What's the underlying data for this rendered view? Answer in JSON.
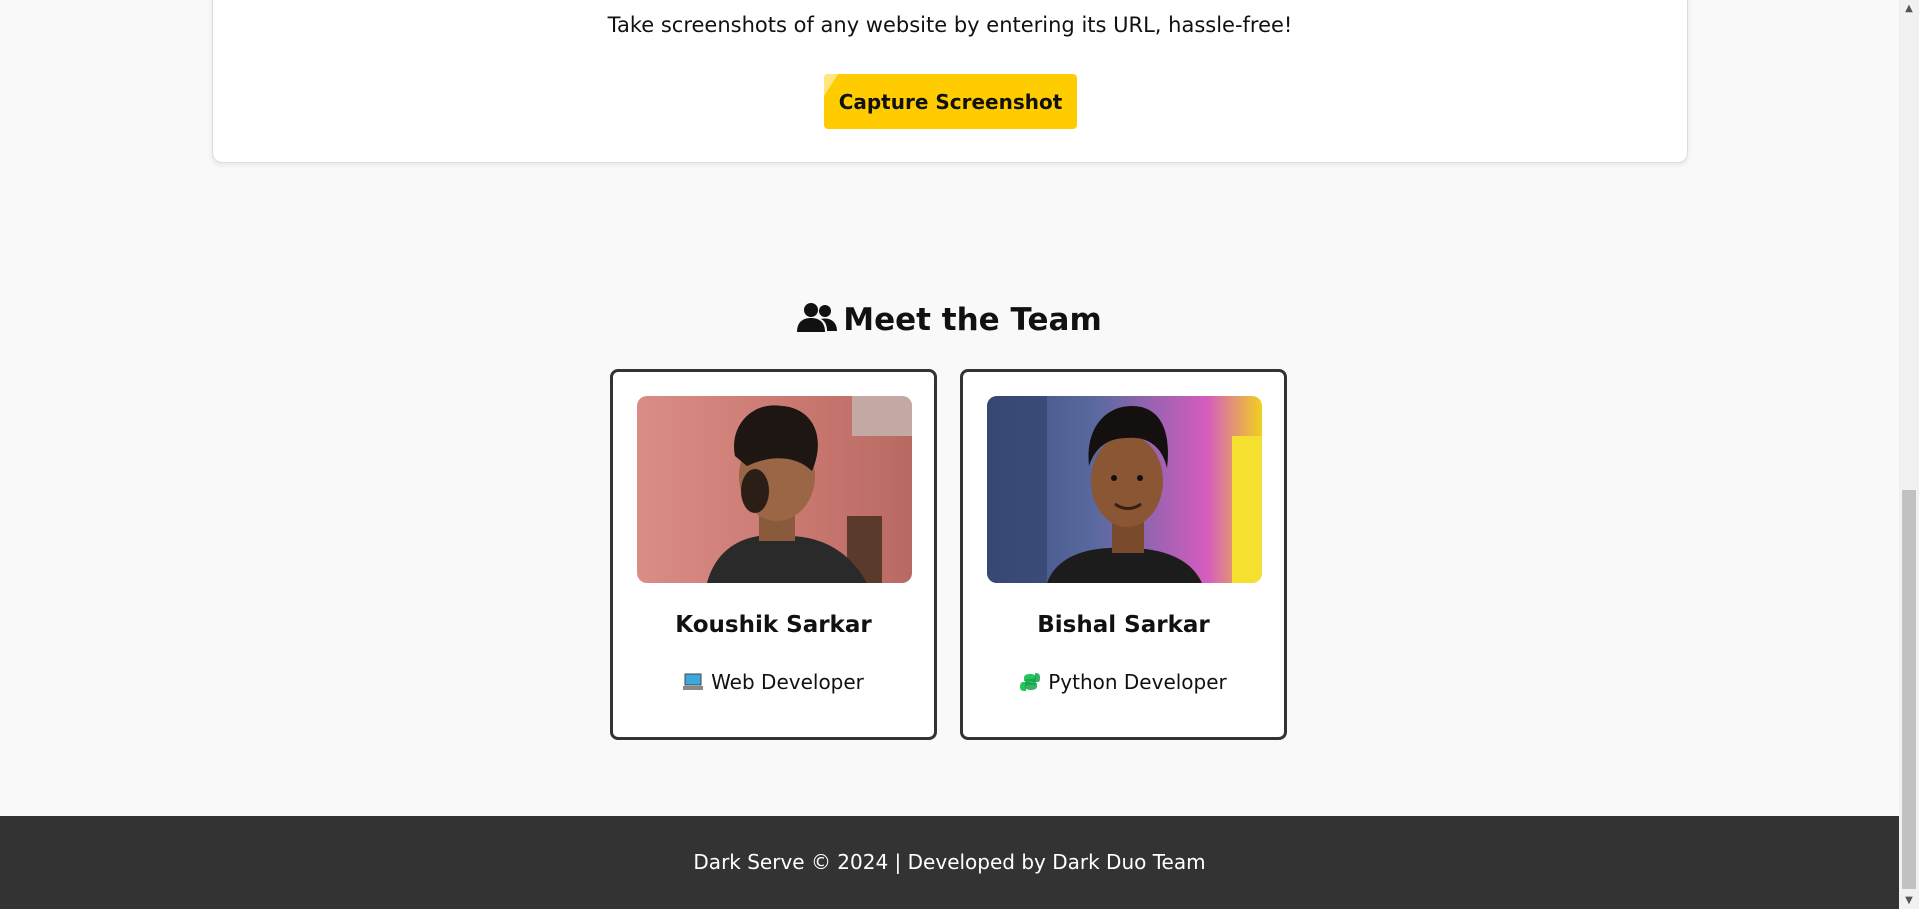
{
  "capture": {
    "subtitle": "Take screenshots of any website by entering its URL, hassle-free!",
    "button_label": "Capture Screenshot"
  },
  "team": {
    "heading": "Meet the Team",
    "heading_icon": "users-icon",
    "members": [
      {
        "name": "Koushik Sarkar",
        "role": "Web Developer",
        "role_icon": "laptop-icon"
      },
      {
        "name": "Bishal Sarkar",
        "role": "Python Developer",
        "role_icon": "python-icon"
      }
    ]
  },
  "footer": {
    "text": "Dark Serve © 2024 | Developed by Dark Duo Team"
  },
  "colors": {
    "accent": "#ffcc00",
    "footer_bg": "#333333",
    "page_bg": "#f9f9f9",
    "python_green": "#22c55e"
  }
}
